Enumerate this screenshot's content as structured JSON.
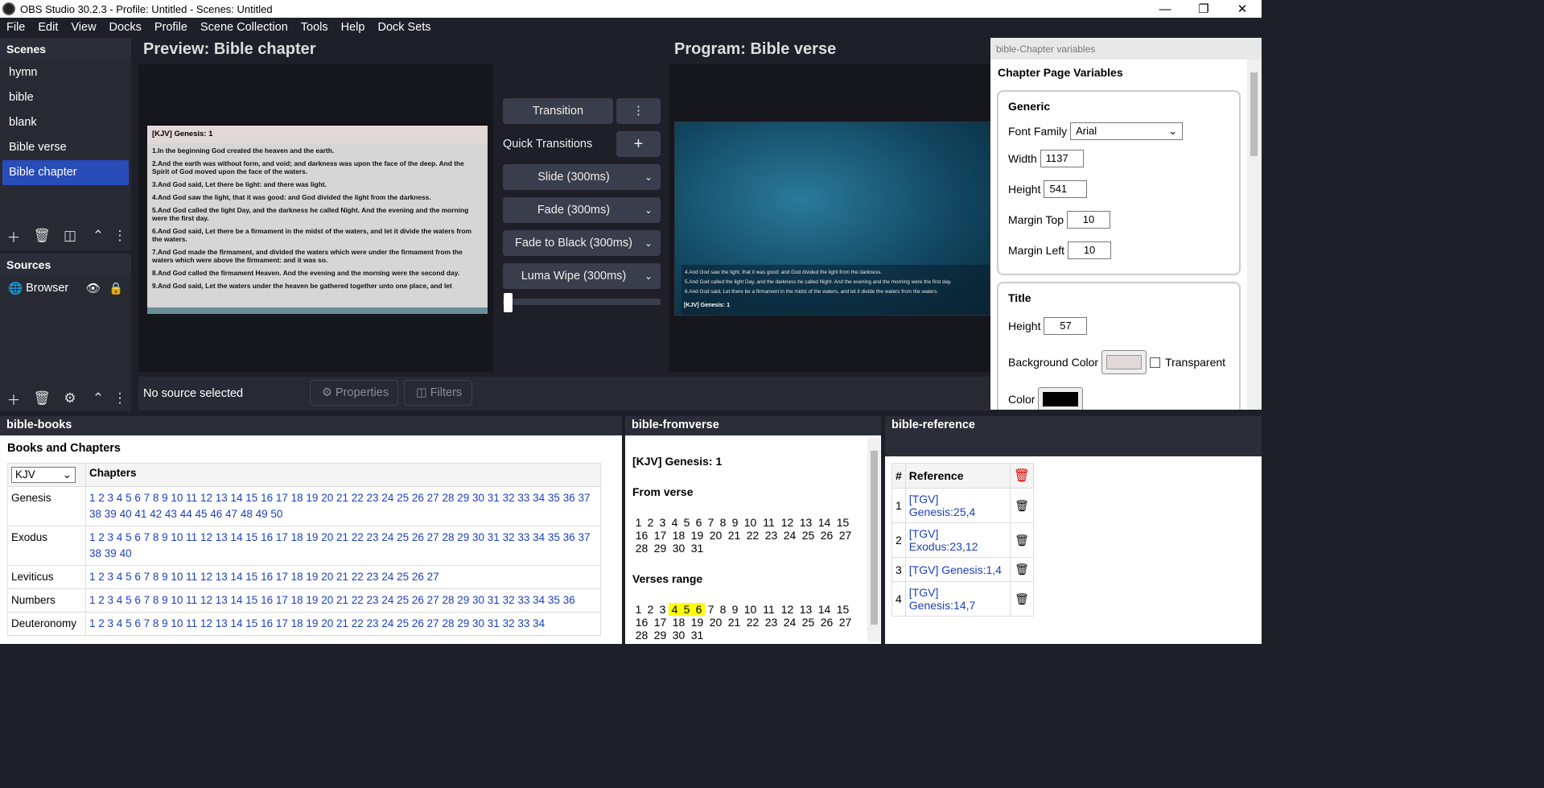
{
  "window": {
    "title": "OBS Studio 30.2.3 - Profile: Untitled - Scenes: Untitled"
  },
  "menu": [
    "File",
    "Edit",
    "View",
    "Docks",
    "Profile",
    "Scene Collection",
    "Tools",
    "Help",
    "Dock Sets"
  ],
  "scenes": {
    "title": "Scenes",
    "items": [
      "hymn",
      "bible",
      "blank",
      "Bible verse",
      "Bible chapter"
    ],
    "selected": "Bible chapter"
  },
  "sources": {
    "title": "Sources",
    "items": [
      {
        "name": "Browser"
      }
    ]
  },
  "preview": {
    "title": "Preview: Bible chapter",
    "chapter_title": "[KJV] Genesis: 1",
    "verses": [
      "1.In the beginning God created the heaven and the earth.",
      "2.And the earth was without form, and void; and darkness was upon the face of the deep. And the Spirit of God moved upon the face of the waters.",
      "3.And God said, Let there be light: and there was light.",
      "4.And God saw the light, that it was good: and God divided the light from the darkness.",
      "5.And God called the light Day, and the darkness he called Night. And the evening and the morning were the first day.",
      "6.And God said, Let there be a firmament in the midst of the waters, and let it divide the waters from the waters.",
      "7.And God made the firmament, and divided the waters which were under the firmament from the waters which were above the firmament: and it was so.",
      "8.And God called the firmament Heaven. And the evening and the morning were the second day.",
      "9.And God said, Let the waters under the heaven be gathered together unto one place, and let"
    ]
  },
  "program": {
    "title": "Program: Bible verse",
    "verses": [
      "4.And God saw the light, that it was good: and God divided the light from the darkness.",
      "5.And God called the light Day, and the darkness he called Night. And the evening and the morning were the first day.",
      "6.And God said, Let there be a firmament in the midst of the waters, and let it divide the waters from the waters."
    ],
    "reference": "[KJV] Genesis: 1"
  },
  "transitions": {
    "transition_label": "Transition",
    "quick_label": "Quick Transitions",
    "items": [
      "Slide (300ms)",
      "Fade (300ms)",
      "Fade to Black (300ms)",
      "Luma Wipe (300ms)"
    ]
  },
  "status": {
    "no_source": "No source selected",
    "properties": "Properties",
    "filters": "Filters"
  },
  "chapter_vars": {
    "dock_title": "bible-Chapter variables",
    "heading": "Chapter Page Variables",
    "generic": {
      "legend": "Generic",
      "font_family_label": "Font Family",
      "font_family": "Arial",
      "width_label": "Width",
      "width": "1137",
      "height_label": "Height",
      "height": "541",
      "margin_top_label": "Margin Top",
      "margin_top": "10",
      "margin_left_label": "Margin Left",
      "margin_left": "10"
    },
    "title": {
      "legend": "Title",
      "height_label": "Height",
      "height": "57",
      "bg_label": "Background Color",
      "bg_color": "#e2d8d8",
      "transparent_label": "Transparent",
      "color_label": "Color",
      "color": "#000000"
    }
  },
  "books": {
    "dock_title": "bible-books",
    "heading": "Books and Chapters",
    "version": "KJV",
    "chapters_header": "Chapters",
    "rows": [
      {
        "name": "Genesis",
        "chapters": 50
      },
      {
        "name": "Exodus",
        "chapters": 40
      },
      {
        "name": "Leviticus",
        "chapters": 27
      },
      {
        "name": "Numbers",
        "chapters": 36
      },
      {
        "name": "Deuteronomy",
        "chapters": 34
      }
    ]
  },
  "fromverse": {
    "dock_title": "bible-fromverse",
    "chapter": "[KJV] Genesis: 1",
    "from_label": "From verse",
    "range_label": "Verses range",
    "verse_count": 31,
    "highlighted": [
      4,
      5,
      6
    ]
  },
  "reference": {
    "dock_title": "bible-reference",
    "col_num": "#",
    "col_ref": "Reference",
    "rows": [
      {
        "n": "1",
        "ref": "[TGV] Genesis:25,4"
      },
      {
        "n": "2",
        "ref": "[TGV] Exodus:23,12"
      },
      {
        "n": "3",
        "ref": "[TGV] Genesis:1,4"
      },
      {
        "n": "4",
        "ref": "[TGV] Genesis:14,7"
      }
    ]
  }
}
